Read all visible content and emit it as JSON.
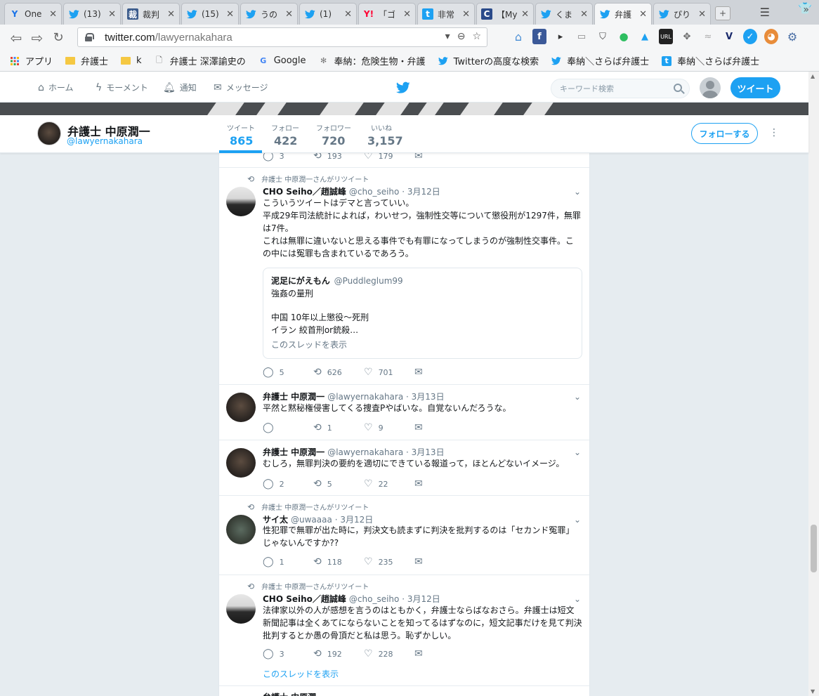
{
  "browser": {
    "tabs": [
      {
        "title": "One",
        "icon": "Y",
        "icon_color": "#1a73e8",
        "icon_bg": "transparent"
      },
      {
        "title": "(13)",
        "icon": "tw",
        "icon_color": "#1da1f2",
        "icon_bg": "transparent"
      },
      {
        "title": "裁判",
        "icon": "裁",
        "icon_color": "#fff",
        "icon_bg": "#3b5b8c"
      },
      {
        "title": "(15)",
        "icon": "tw",
        "icon_color": "#1da1f2",
        "icon_bg": "transparent"
      },
      {
        "title": "うの",
        "icon": "tw",
        "icon_color": "#1da1f2",
        "icon_bg": "transparent"
      },
      {
        "title": "(1)",
        "icon": "tw",
        "icon_color": "#1da1f2",
        "icon_bg": "transparent"
      },
      {
        "title": "「ゴ",
        "icon": "Y!",
        "icon_color": "#ff0033",
        "icon_bg": "transparent"
      },
      {
        "title": "非常",
        "icon": "t",
        "icon_color": "#fff",
        "icon_bg": "#1da1f2"
      },
      {
        "title": "【My",
        "icon": "C",
        "icon_color": "#fff",
        "icon_bg": "#2a4a8a"
      },
      {
        "title": "くま",
        "icon": "tw",
        "icon_color": "#1da1f2",
        "icon_bg": "transparent"
      },
      {
        "title": "弁護",
        "icon": "tw",
        "icon_color": "#1da1f2",
        "icon_bg": "transparent",
        "active": true
      },
      {
        "title": "ぴり",
        "icon": "tw",
        "icon_color": "#1da1f2",
        "icon_bg": "transparent"
      }
    ],
    "url_host": "twitter.com",
    "url_path": "/lawyernakahara",
    "bookmarks": [
      {
        "label": "アプリ",
        "icon": "apps"
      },
      {
        "label": "弁護士",
        "icon": "folder"
      },
      {
        "label": "k",
        "icon": "folder"
      },
      {
        "label": "弁護士 深澤諭史の",
        "icon": "page"
      },
      {
        "label": "Google",
        "icon": "google"
      },
      {
        "label": "奉納：危険生物・弁護",
        "icon": "bee"
      },
      {
        "label": "Twitterの高度な検索",
        "icon": "tw"
      },
      {
        "label": "奉納＼さらば弁護士",
        "icon": "tw"
      },
      {
        "label": "奉納＼さらば弁護士",
        "icon": "t"
      }
    ]
  },
  "twitter_nav": {
    "home": "ホーム",
    "moments": "モーメント",
    "notifications": "通知",
    "messages": "メッセージ",
    "search_placeholder": "キーワード検索",
    "tweet_button": "ツイート"
  },
  "profile": {
    "name": "弁護士 中原潤一",
    "handle": "@lawyernakahara",
    "stats": [
      {
        "label": "ツイート",
        "value": "865",
        "active": true
      },
      {
        "label": "フォロー",
        "value": "422"
      },
      {
        "label": "フォロワー",
        "value": "720"
      },
      {
        "label": "いいね",
        "value": "3,157"
      }
    ],
    "follow_button": "フォローする"
  },
  "partial_top_actions": {
    "reply": "3",
    "retweet": "193",
    "like": "179"
  },
  "tweets": [
    {
      "rt_label": "弁護士 中原潤一さんがリツイート",
      "name": "CHO Seiho／趙誠峰",
      "handle": "@cho_seiho",
      "date": "· 3月12日",
      "lines": [
        "こういうツイートはデマと言っていい。",
        "平成29年司法統計によれば，わいせつ，強制性交等について懲役刑が1297件，無罪は7件。",
        "これは無罪に違いないと思える事件でも有罪になってしまうのが強制性交事件。この中には冤罪も含まれているであろう。"
      ],
      "quote": {
        "name": "泥足にがえもん",
        "handle": "@Puddleglum99",
        "line1": "強姦の量刑",
        "line2": "中国 10年以上懲役〜死刑",
        "line3": "イラン 絞首刑or銃殺…",
        "link": "このスレッドを表示"
      },
      "reply": "5",
      "retweet": "626",
      "like": "701"
    },
    {
      "name": "弁護士 中原潤一",
      "handle": "@lawyernakahara",
      "date": "· 3月13日",
      "lines": [
        "平然と黙秘権侵害してくる捜査Pやばいな。自覚ないんだろうな。"
      ],
      "reply": "",
      "retweet": "1",
      "like": "9"
    },
    {
      "name": "弁護士 中原潤一",
      "handle": "@lawyernakahara",
      "date": "· 3月13日",
      "lines": [
        "むしろ，無罪判決の要約を適切にできている報道って，ほとんどないイメージ。"
      ],
      "reply": "2",
      "retweet": "5",
      "like": "22"
    },
    {
      "rt_label": "弁護士 中原潤一さんがリツイート",
      "name": "サイ太",
      "handle": "@uwaaaa",
      "date": "· 3月12日",
      "lines": [
        "性犯罪で無罪が出た時に，判決文も読まずに判決を批判するのは「セカンド冤罪」じゃないんですか??"
      ],
      "reply": "1",
      "retweet": "118",
      "like": "235"
    },
    {
      "rt_label": "弁護士 中原潤一さんがリツイート",
      "name": "CHO Seiho／趙誠峰",
      "handle": "@cho_seiho",
      "date": "· 3月12日",
      "lines": [
        "法律家以外の人が感想を言うのはともかく，弁護士ならばなおさら。弁護士は短文新聞記事は全くあてにならないことを知ってるはずなのに，短文記事だけを見て判決批判するとか愚の骨頂だと私は思う。恥ずかしい。"
      ],
      "reply": "3",
      "retweet": "192",
      "like": "228",
      "thread_link": "このスレッドを表示"
    }
  ]
}
